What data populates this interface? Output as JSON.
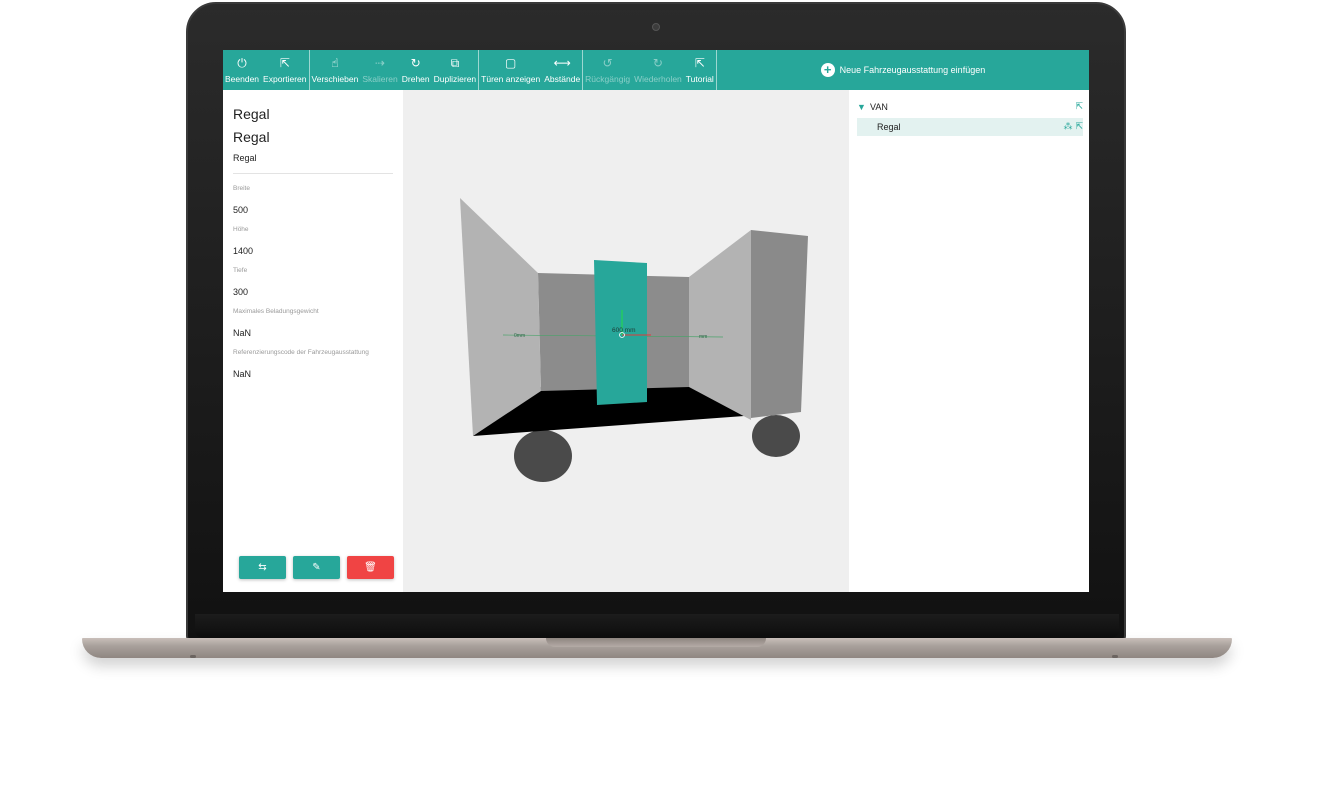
{
  "toolbar": {
    "groups": [
      [
        {
          "icon": "power-icon",
          "glyph": "⏻",
          "label": "Beenden",
          "enabled": true
        },
        {
          "icon": "external-link-icon",
          "glyph": "⇱",
          "label": "Exportieren",
          "enabled": true
        }
      ],
      [
        {
          "icon": "hand-pointer-icon",
          "glyph": "☝",
          "label": "Verschieben",
          "enabled": true
        },
        {
          "icon": "scale-icon",
          "glyph": "⇢",
          "label": "Skalieren",
          "enabled": false
        },
        {
          "icon": "rotate-icon",
          "glyph": "↻",
          "label": "Drehen",
          "enabled": true
        },
        {
          "icon": "copy-icon",
          "glyph": "⧉",
          "label": "Duplizieren",
          "enabled": true
        }
      ],
      [
        {
          "icon": "square-icon",
          "glyph": "▢",
          "label": "Türen anzeigen",
          "enabled": true
        },
        {
          "icon": "distances-icon",
          "glyph": "⟷",
          "label": "Abstände",
          "enabled": true
        }
      ],
      [
        {
          "icon": "undo-icon",
          "glyph": "↺",
          "label": "Rückgängig",
          "enabled": false
        },
        {
          "icon": "redo-icon",
          "glyph": "↻",
          "label": "Wiederholen",
          "enabled": false
        },
        {
          "icon": "external-link-icon",
          "glyph": "⇱",
          "label": "Tutorial",
          "enabled": true
        }
      ]
    ],
    "add_label": "Neue Fahrzeugausstattung einfügen"
  },
  "properties": {
    "title_1": "Regal",
    "title_2": "Regal",
    "title_3": "Regal",
    "fields": [
      {
        "label": "Breite",
        "value": "500"
      },
      {
        "label": "Höhe",
        "value": "1400"
      },
      {
        "label": "Tiefe",
        "value": "300"
      },
      {
        "label": "Maximales Beladungsgewicht",
        "value": "NaN"
      },
      {
        "label": "Referenzierungscode der Fahrzeugausstattung",
        "value": "NaN"
      }
    ],
    "buttons": {
      "measure": "⇆",
      "edit": "✎",
      "delete": "🗑"
    }
  },
  "viewport": {
    "dim_left": "0mm",
    "dim_center": "600 mm",
    "dim_right": "mm"
  },
  "tree": {
    "root": "VAN",
    "child": "Regal",
    "glyph_ext": "⇱",
    "glyph_group": "⁂"
  },
  "colors": {
    "accent": "#27a79a",
    "danger": "#f04444"
  }
}
